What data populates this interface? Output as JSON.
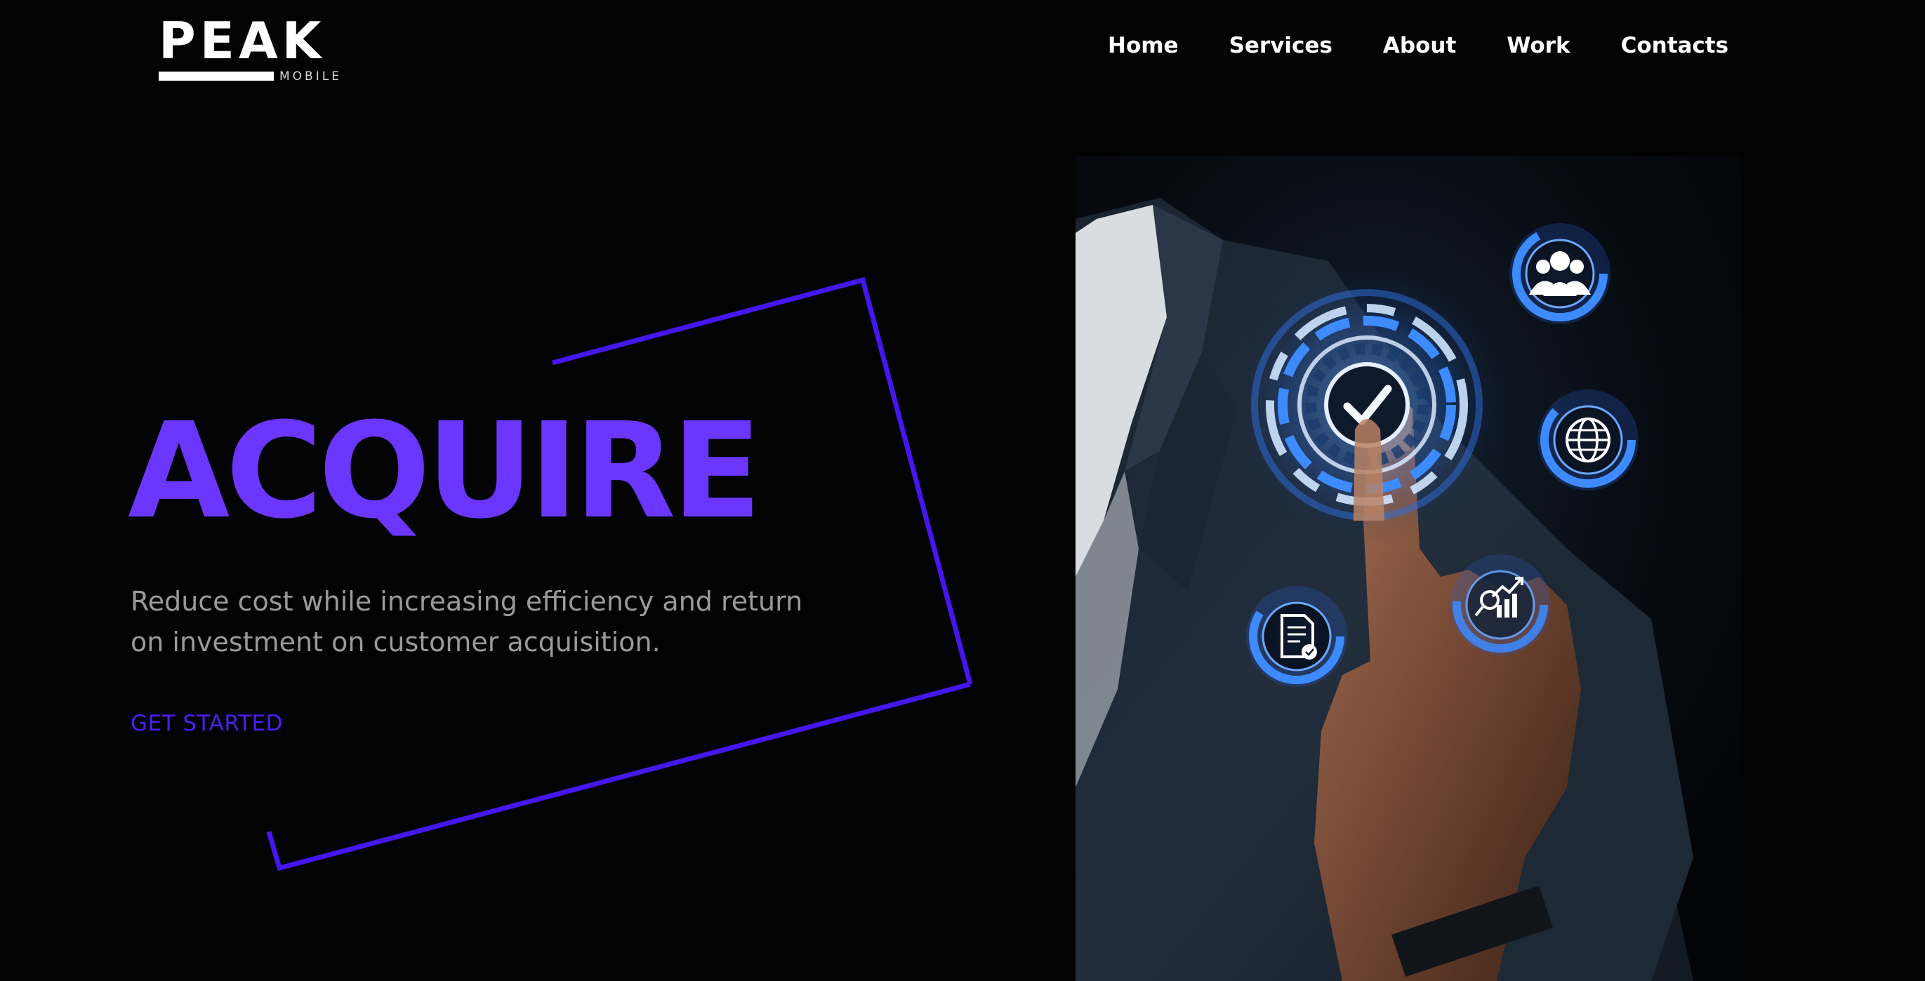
{
  "brand": {
    "name": "PEAK",
    "tagline": "MOBILE"
  },
  "nav": {
    "items": [
      "Home",
      "Services",
      "About",
      "Work",
      "Contacts"
    ]
  },
  "hero": {
    "title": "ACQUIRE",
    "description": "Reduce cost while increasing efficiency and return on investment on customer acquisition.",
    "cta": "GET STARTED"
  },
  "image": {
    "subject": "businessman touching holographic interface",
    "icons": [
      "check-icon",
      "users-icon",
      "globe-icon",
      "document-icon",
      "analytics-icon"
    ]
  },
  "colors": {
    "background": "#030303",
    "accent": "#6b36ff",
    "frame": "#4516f0",
    "nav_text": "#ffffff",
    "body_text": "#9a9a9a",
    "hologram": "#3d8bff"
  }
}
